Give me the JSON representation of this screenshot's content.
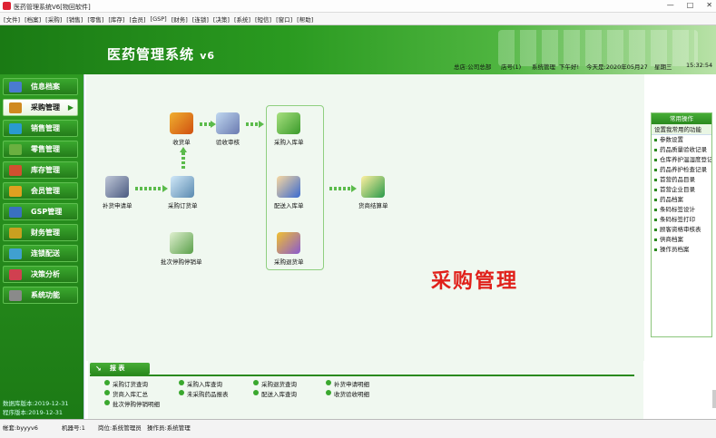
{
  "window": {
    "title": "医药管理系统V6[物回软件]",
    "buttons": [
      "—",
      "□",
      "✕"
    ]
  },
  "menu": [
    "[文件]",
    "[档案]",
    "[采购]",
    "[销售]",
    "[零售]",
    "[库存]",
    "[会员]",
    "[GSP]",
    "[财务]",
    "[连锁]",
    "[决策]",
    "[系统]",
    "[短信]",
    "[窗口]",
    "[帮助]"
  ],
  "banner": {
    "brand": "医药管理系统",
    "version": "v6"
  },
  "info": {
    "branch": "总店:公司总部",
    "store": "店号(1)",
    "user": "系统管理",
    "greeting": "下午好!",
    "date": "今天是:2020年05月27",
    "weekday": "星期三",
    "time": "15:32:54"
  },
  "sidebar": {
    "items": [
      {
        "label": "信息档案",
        "color": "#4a7bd0"
      },
      {
        "label": "采购管理",
        "color": "#d08a20",
        "active": true
      },
      {
        "label": "销售管理",
        "color": "#2a9ad0"
      },
      {
        "label": "零售管理",
        "color": "#6ab040"
      },
      {
        "label": "库存管理",
        "color": "#d05030"
      },
      {
        "label": "会员管理",
        "color": "#e0a020"
      },
      {
        "label": "GSP管理",
        "color": "#3a70c0"
      },
      {
        "label": "财务管理",
        "color": "#c8a020"
      },
      {
        "label": "连锁配送",
        "color": "#40a0d0"
      },
      {
        "label": "决策分析",
        "color": "#d04050"
      },
      {
        "label": "系统功能",
        "color": "#8a8a8a"
      }
    ],
    "footer": [
      "数据库版本:2019-12-31",
      "程序版本:2019-12-31"
    ]
  },
  "flow": {
    "nodes": [
      "收货单",
      "验收审核",
      "采购入库单",
      "补货申请单",
      "采购订货单",
      "配送入库单",
      "货商结算单",
      "批次停购停销单",
      "采购退货单"
    ]
  },
  "big_title": "采购管理",
  "right_panel": {
    "header": "常用操作",
    "setup": "设置我常用的功能",
    "items": [
      "参数设置",
      "药品质量验收记录",
      "仓库养护温湿度登记",
      "药品养护检查记录",
      "首营药品目录",
      "首营企业目录",
      "药品档案",
      "条码标签设计",
      "条码标签打印",
      "顾客资格审核表",
      "供商档案",
      "操作员档案"
    ]
  },
  "reports": {
    "tab": "报 表",
    "links": [
      "采购订货查询",
      "采购入库查询",
      "采购退货查询",
      "补货申请明细",
      "货商入库汇总",
      "未采购药品报表",
      "配送入库查询",
      "收货验收明细",
      "批次停购停销明细"
    ]
  },
  "status": {
    "account": "帐套:byyyv6",
    "machine": "机器号:1",
    "post": "岗位:系统管理员",
    "operator": "操作员:系统管理"
  }
}
